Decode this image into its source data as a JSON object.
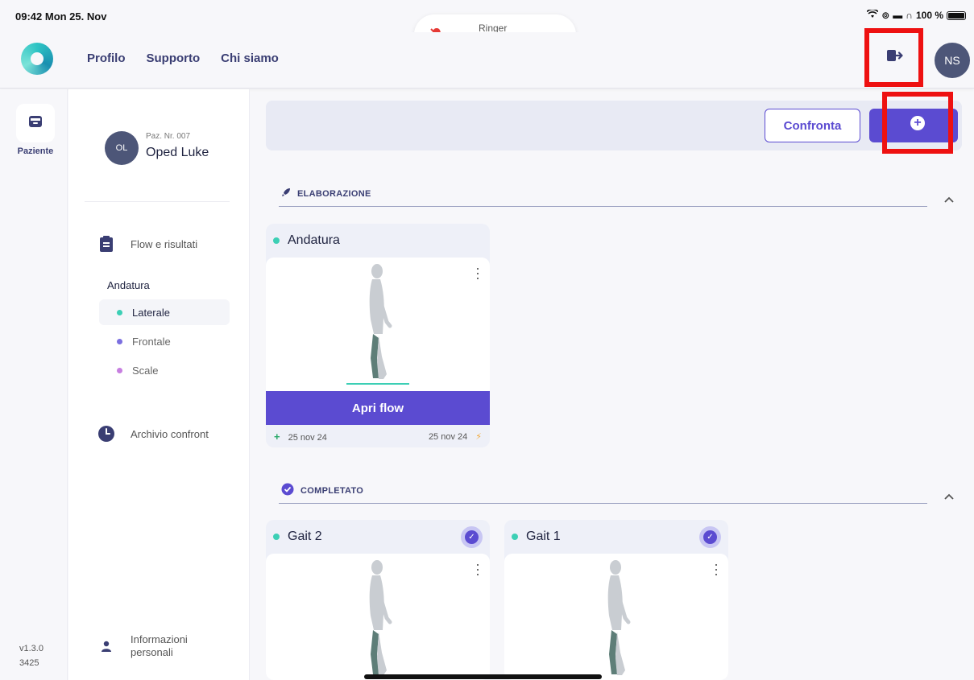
{
  "status": {
    "time": "09:42  Mon 25. Nov",
    "battery": "100 %"
  },
  "ringer": {
    "label": "Ringer",
    "level": 0.05
  },
  "header": {
    "nav": [
      "Profilo",
      "Supporto",
      "Chi siamo"
    ],
    "user_initials": "NS"
  },
  "rail": {
    "patient_label": "Paziente",
    "version": "v1.3.0",
    "build": "3425"
  },
  "patient": {
    "initials": "OL",
    "number": "Paz. Nr. 007",
    "name": "Oped Luke"
  },
  "sidebar": {
    "flow_label": "Flow e risultati",
    "group_label": "Andatura",
    "sub_items": [
      {
        "label": "Laterale",
        "color": "#3ccfb5"
      },
      {
        "label": "Frontale",
        "color": "#7b6fe0"
      },
      {
        "label": "Scale",
        "color": "#c77fe0"
      }
    ],
    "archive_label": "Archivio confront",
    "personal_label_1": "Informazioni",
    "personal_label_2": "personali"
  },
  "toolbar": {
    "compare_label": "Confronta"
  },
  "sections": {
    "processing": "ELABORAZIONE",
    "completed": "COMPLETATO"
  },
  "processing_card": {
    "title": "Andatura",
    "open_label": "Apri flow",
    "created": "25 nov 24",
    "updated": "25 nov 24"
  },
  "completed_cards": [
    {
      "title": "Gait 2"
    },
    {
      "title": "Gait 1"
    }
  ],
  "colors": {
    "accent": "#5b4bd1",
    "highlight": "#ee1111",
    "teal": "#3ccfb5"
  }
}
